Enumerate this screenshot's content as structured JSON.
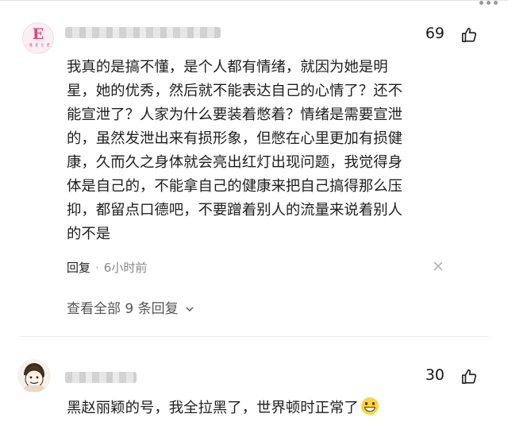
{
  "comments": [
    {
      "likes": "69",
      "avatar_letter": "E",
      "avatar_tagline": "· 雅 昊 方 是",
      "body_lines": [
        "我真的是搞不懂，是个人都有情绪，就因为她是明",
        "星，她的优秀，然后就不能表达自己的心情了？还不",
        "能宣泄了？人家为什么要装着憋着？情绪是需要宣泄",
        "的，虽然发泄出来有损形象，但憋在心里更加有损健",
        "康，久而久之身体就会亮出红灯出现问题，我觉得身",
        "体是自己的，不能拿自己的健康来把自己搞得那么压",
        "抑，都留点口德吧，不要蹭着别人的流量来说着别人",
        "的不是"
      ],
      "reply_label": "回复",
      "separator": "·",
      "time": "6小时前",
      "view_replies": "查看全部 9 条回复"
    },
    {
      "likes": "30",
      "body": "黑赵丽颖的号，我全拉黑了，世界顿时正常了"
    }
  ]
}
